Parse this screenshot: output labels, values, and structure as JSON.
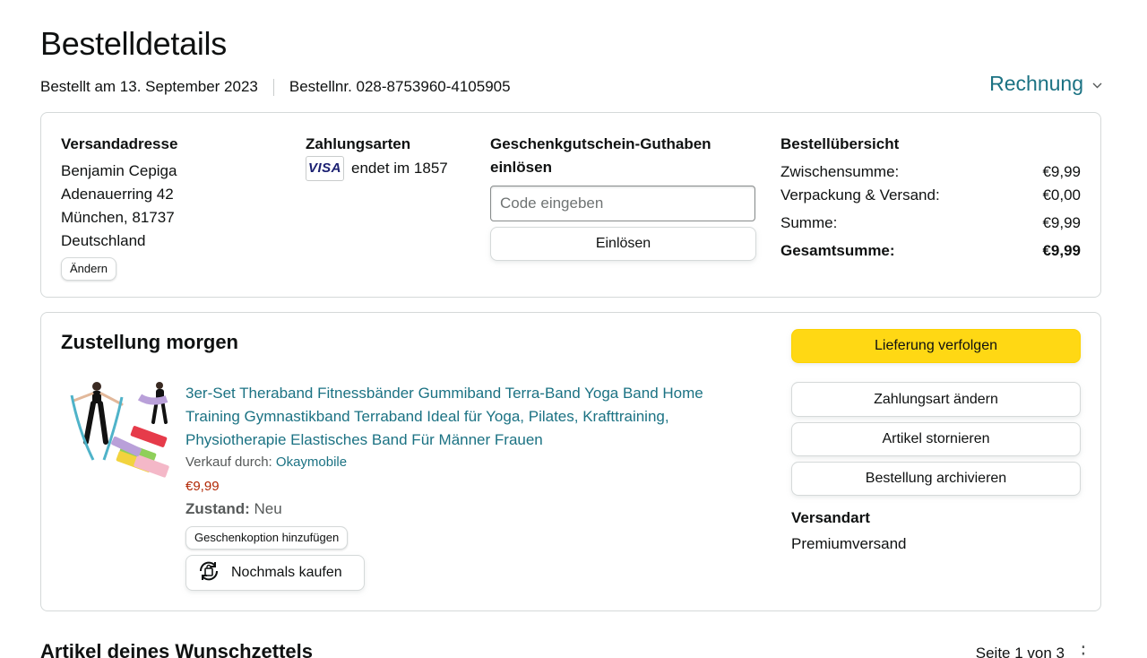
{
  "header": {
    "title": "Bestelldetails",
    "order_date": "Bestellt am 13. September 2023",
    "order_number": "Bestellnr. 028-8753960-4105905",
    "invoice_label": "Rechnung",
    "invoice_icon": "chevron-down-icon"
  },
  "shipping": {
    "heading": "Versandadresse",
    "lines": [
      "Benjamin Cepiga",
      "Adenauerring 42",
      "München, 81737",
      "Deutschland"
    ],
    "change_label": "Ändern"
  },
  "payment": {
    "heading": "Zahlungsarten",
    "card_brand": "VISA",
    "card_text": "endet im 1857"
  },
  "giftcard": {
    "heading_line1": "Geschenkgutschein-Guthaben",
    "heading_line2": "einlösen",
    "placeholder": "Code eingeben",
    "redeem_label": "Einlösen"
  },
  "summary": {
    "heading": "Bestellübersicht",
    "rows": [
      {
        "label": "Zwischensumme:",
        "value": "€9,99"
      },
      {
        "label": "Verpackung & Versand:",
        "value": "€0,00"
      },
      {
        "label": "Summe:",
        "value": "€9,99"
      },
      {
        "label": "Gesamtsumme:",
        "value": "€9,99"
      }
    ]
  },
  "delivery": {
    "title": "Zustellung morgen",
    "product_title": "3er-Set Theraband Fitnessbänder Gummiband Terra-Band Yoga Band Home Training Gymnastikband Terraband Ideal für Yoga, Pilates, Krafttraining, Physiotherapie Elastisches Band Für Männer Frauen",
    "sold_by_label": "Verkauf durch:",
    "seller": "Okaymobile",
    "price": "€9,99",
    "condition_label": "Zustand:",
    "condition_value": "Neu",
    "gift_option_label": "Geschenkoption hinzufügen",
    "buy_again_label": "Nochmals kaufen",
    "actions": {
      "track": "Lieferung verfolgen",
      "change_payment": "Zahlungsart ändern",
      "cancel": "Artikel stornieren",
      "archive": "Bestellung archivieren"
    },
    "shipping_type_heading": "Versandart",
    "shipping_type_value": "Premiumversand"
  },
  "wishlist": {
    "title": "Artikel deines Wunschzettels",
    "pager": "Seite 1 von 3"
  },
  "colors": {
    "link": "#1b7283",
    "price": "#b12704",
    "primary_button": "#ffd814"
  }
}
